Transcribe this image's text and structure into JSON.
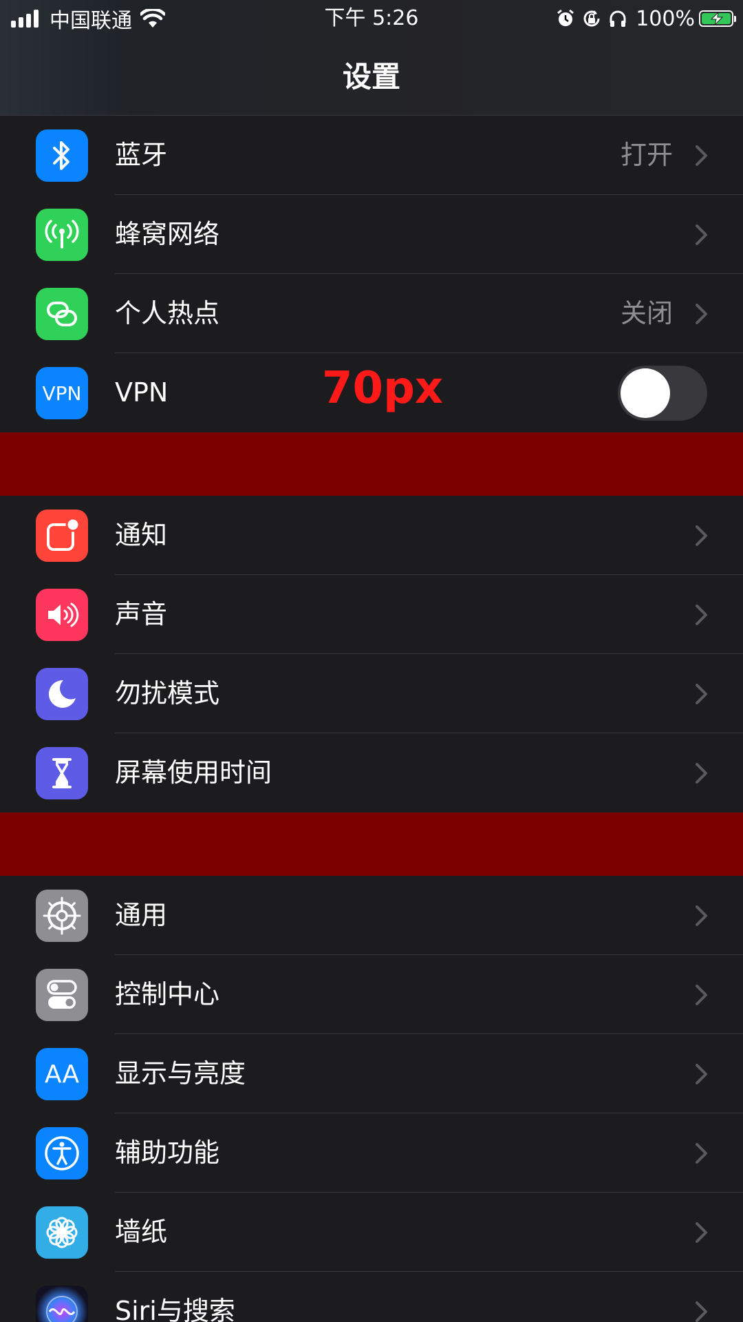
{
  "status_bar": {
    "carrier": "中国联通",
    "time": "下午 5:26",
    "battery_percent": "100%",
    "battery_level": 1.0,
    "icons": [
      "signal-icon",
      "wifi-icon",
      "alarm-icon",
      "rotation-lock-icon",
      "headphones-icon",
      "battery-charging-icon"
    ]
  },
  "nav": {
    "title": "设置"
  },
  "annotation": "70px",
  "colors": {
    "background": "#1c1c1e",
    "spacer": "#7c0000",
    "annotation": "#ff1a1a",
    "detail_text": "#8e8e93",
    "separator": "#38383c"
  },
  "group1": {
    "bluetooth": {
      "label": "蓝牙",
      "detail": "打开",
      "icon": "bluetooth-icon",
      "color": "#0a84ff"
    },
    "cellular": {
      "label": "蜂窝网络",
      "icon": "antenna-icon",
      "color": "#30d158"
    },
    "hotspot": {
      "label": "个人热点",
      "detail": "关闭",
      "icon": "hotspot-link-icon",
      "color": "#30d158"
    },
    "vpn": {
      "label": "VPN",
      "icon_text": "VPN",
      "icon": "vpn-icon",
      "color": "#0a84ff",
      "toggle_on": false
    }
  },
  "group2": {
    "notifications": {
      "label": "通知",
      "icon": "notifications-icon",
      "color": "#ff453a"
    },
    "sounds": {
      "label": "声音",
      "icon": "speaker-icon",
      "color": "#ff375f"
    },
    "dnd": {
      "label": "勿扰模式",
      "icon": "moon-icon",
      "color": "#5e5ce6"
    },
    "screen_time": {
      "label": "屏幕使用时间",
      "icon": "hourglass-icon",
      "color": "#5e5ce6"
    }
  },
  "group3": {
    "general": {
      "label": "通用",
      "icon": "gear-icon",
      "color": "#8e8e93"
    },
    "control_center": {
      "label": "控制中心",
      "icon": "switches-icon",
      "color": "#8e8e93"
    },
    "display": {
      "label": "显示与亮度",
      "icon_text": "AA",
      "icon": "text-size-icon",
      "color": "#0a84ff"
    },
    "accessibility": {
      "label": "辅助功能",
      "icon": "accessibility-icon",
      "color": "#0a84ff"
    },
    "wallpaper": {
      "label": "墙纸",
      "icon": "flower-icon",
      "color": "#32ade6"
    },
    "siri": {
      "label": "Siri与搜索",
      "icon": "siri-icon",
      "color": "#1a1a2e"
    }
  }
}
